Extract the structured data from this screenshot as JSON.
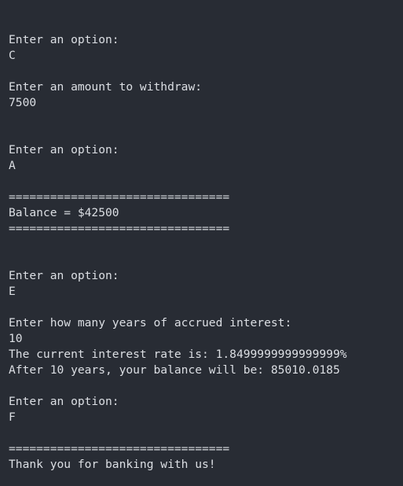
{
  "terminal": {
    "lines": [
      "Enter an option:",
      "C",
      "",
      "Enter an amount to withdraw:",
      "7500",
      "",
      "",
      "Enter an option:",
      "A",
      "",
      "================================",
      "Balance = $42500",
      "================================",
      "",
      "",
      "Enter an option:",
      "E",
      "",
      "Enter how many years of accrued interest:",
      "10",
      "The current interest rate is: 1.8499999999999999%",
      "After 10 years, your balance will be: 85010.0185",
      "",
      "Enter an option:",
      "F",
      "",
      "================================",
      "Thank you for banking with us!"
    ]
  }
}
